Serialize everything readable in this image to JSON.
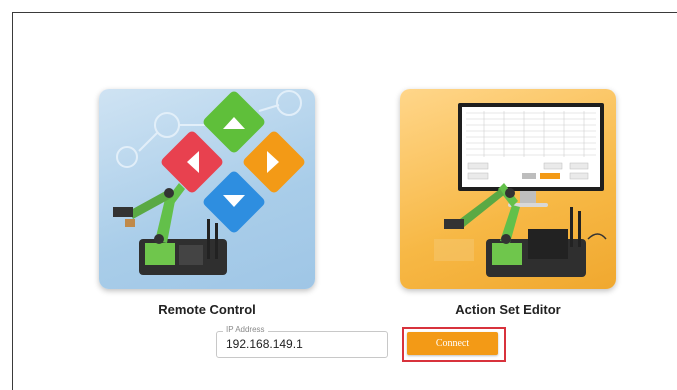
{
  "cards": {
    "remote_control": {
      "label": "Remote Control"
    },
    "action_set_editor": {
      "label": "Action Set Editor"
    }
  },
  "ip_field": {
    "legend": "IP Address",
    "value": "192.168.149.1"
  },
  "connect_button": {
    "label": "Connect"
  },
  "colors": {
    "arrow_green": "#5fbf3a",
    "arrow_red": "#e8414f",
    "arrow_orange": "#f39a16",
    "arrow_blue": "#2e8ee0",
    "button_orange": "#f39a16",
    "highlight_red": "#d8323c"
  },
  "icons": {
    "up": "arrow-up-icon",
    "left": "arrow-left-icon",
    "right": "arrow-right-icon",
    "down": "arrow-down-icon"
  }
}
